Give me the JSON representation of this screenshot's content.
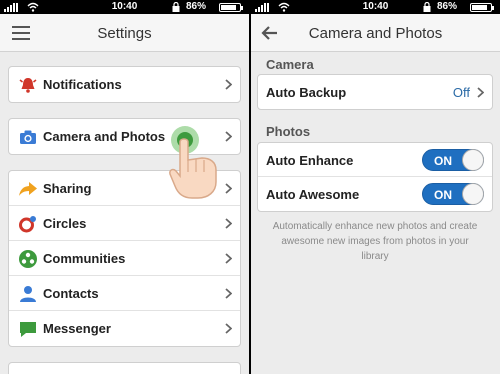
{
  "left": {
    "status": {
      "time": "10:40",
      "battery": "86%",
      "battery_level": 0.86
    },
    "header": {
      "title": "Settings",
      "menu_icon": "hamburger-menu-icon"
    },
    "groups": [
      [
        {
          "id": "notifications",
          "label": "Notifications",
          "icon": "alarm-bell-icon",
          "color": "#d0362a"
        }
      ],
      [
        {
          "id": "camera-and-photos",
          "label": "Camera and Photos",
          "icon": "camera-icon",
          "color": "#3a7bd5"
        }
      ],
      [
        {
          "id": "sharing",
          "label": "Sharing",
          "icon": "share-arrow-icon",
          "color": "#f0a21f"
        },
        {
          "id": "circles",
          "label": "Circles",
          "icon": "circles-icon",
          "color": "#d0362a"
        },
        {
          "id": "communities",
          "label": "Communities",
          "icon": "communities-icon",
          "color": "#3d9a3d"
        },
        {
          "id": "contacts",
          "label": "Contacts",
          "icon": "person-icon",
          "color": "#3a7bd5"
        },
        {
          "id": "messenger",
          "label": "Messenger",
          "icon": "speech-bubble-icon",
          "color": "#3d9a3d"
        }
      ]
    ]
  },
  "right": {
    "status": {
      "time": "10:40",
      "battery": "86%",
      "battery_level": 0.86
    },
    "header": {
      "title": "Camera and Photos",
      "back_icon": "back-arrow-icon"
    },
    "camera_section": {
      "title": "Camera",
      "auto_backup": {
        "label": "Auto Backup",
        "value": "Off"
      }
    },
    "photos_section": {
      "title": "Photos",
      "auto_enhance": {
        "label": "Auto Enhance",
        "state": "ON"
      },
      "auto_awesome": {
        "label": "Auto Awesome",
        "state": "ON"
      }
    },
    "footnote": "Automatically enhance new photos and create awesome new images from photos in your library"
  },
  "colors": {
    "toggle_on": "#1f6fc0",
    "value_blue": "#2a6aa6",
    "background": "#ececec"
  }
}
